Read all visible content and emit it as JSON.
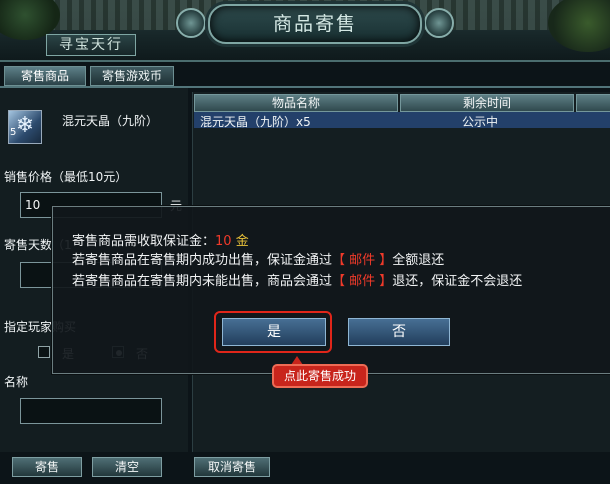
{
  "window": {
    "title": "商品寄售",
    "subtitle": "寻宝天行"
  },
  "tabs": [
    {
      "label": "寄售商品",
      "active": true
    },
    {
      "label": "寄售游戏币",
      "active": false
    }
  ],
  "item": {
    "name": "混元天晶（九阶）",
    "count": "5",
    "icon": "crystal-icon"
  },
  "form": {
    "price_label": "销售价格（最低10元）",
    "price_value": "10",
    "price_unit": "元",
    "days_label": "寄售天数（1",
    "days_value": "",
    "designate_label": "指定玩家购买",
    "option_yes": "是",
    "option_no": "否",
    "selected": "否",
    "name_label": "名称",
    "name_value": ""
  },
  "table": {
    "headers": [
      "物品名称",
      "剩余时间"
    ],
    "rows": [
      {
        "name": "混元天晶（九阶）x5",
        "time": "公示中"
      }
    ]
  },
  "buttons": {
    "sell": "寄售",
    "clear": "清空",
    "cancel_sell": "取消寄售"
  },
  "dialog": {
    "line1_prefix": "寄售商品需收取保证金：",
    "deposit_amount": "10",
    "deposit_unit": "金",
    "line2_prefix": "若寄售商品在寄售期内成功出售，保证金通过",
    "line2_mail": "【 邮件 】",
    "line2_suffix": "全额退还",
    "line3_prefix": "若寄售商品在寄售期内未能出售，商品会通过",
    "line3_mail": "【 邮件 】",
    "line3_suffix": "退还，保证金不会退还",
    "yes_label": "是",
    "no_label": "否"
  },
  "tooltip": "点此寄售成功",
  "colors": {
    "accent_red": "#ef3a2a",
    "gold": "#e9c23a",
    "button_blue": "#476f94"
  }
}
